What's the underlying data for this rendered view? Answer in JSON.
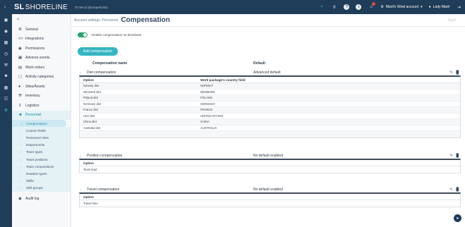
{
  "topbar": {
    "brand_logo": "SL",
    "brand_name": "SHORELINE",
    "timezone": "07:59:43 (Europe/Oslo)",
    "account_label": "Marit's Wind account",
    "user_label": "Lady Marit",
    "icons": [
      "menu-icon",
      "wifi-icon",
      "search-icon",
      "help-icon",
      "info-icon",
      "bell-icon",
      "gear-icon",
      "user-icon",
      "logout-icon"
    ]
  },
  "rail": {
    "icons": [
      "dashboard-icon",
      "location-icon",
      "folder-icon",
      "clock-icon",
      "wrench-icon",
      "team-icon",
      "calendar-icon",
      "grid-icon",
      "settings-icon"
    ]
  },
  "sidebar": {
    "back_label": "<",
    "items": [
      {
        "label": "General",
        "icon": "gear-icon"
      },
      {
        "label": "Integrations",
        "icon": "code-icon"
      },
      {
        "label": "Permissions",
        "icon": "shield-icon"
      },
      {
        "label": "Adverse events",
        "icon": "calendar-icon"
      },
      {
        "label": "Work orders",
        "icon": "clipboard-icon"
      },
      {
        "label": "Activity categories",
        "icon": "tag-icon"
      },
      {
        "label": "Sites/Assets",
        "icon": "pin-icon"
      },
      {
        "label": "Inventory",
        "icon": "wrench-icon"
      },
      {
        "label": "Logistics",
        "icon": "route-icon"
      },
      {
        "label": "Personnel",
        "icon": "person-icon"
      }
    ],
    "personnel_subitems": [
      "Compensation",
      "Custom fields",
      "Personnel roles",
      "Departments",
      "Team types",
      "Team positions",
      "Team compositions",
      "Rotation types",
      "Skills",
      "Skill groups"
    ],
    "audit_label": "Audit log"
  },
  "header": {
    "breadcrumb": "Account settings: Personnel:",
    "title": "Compensation",
    "save_label": "Save"
  },
  "toggle": {
    "label": "Enable compensation on timesheet",
    "enabled": true
  },
  "add_button_label": "Add compensation",
  "table": {
    "col_name": "Compensation name",
    "col_default": "Default"
  },
  "sections": [
    {
      "name": "Diet compensation",
      "default": "Advanced default",
      "col1": "Option",
      "col2": "Work package's country field",
      "rows": [
        [
          "Norway diet",
          "NORWAY"
        ],
        [
          "Denmark diet",
          "DENMARK"
        ],
        [
          "Poland diet",
          "POLAND"
        ],
        [
          "Germany diet",
          "GERMANY"
        ],
        [
          "France diet",
          "FRANCE"
        ],
        [
          "USA diet",
          "UNITED STATES"
        ],
        [
          "China diet",
          "CHINA"
        ],
        [
          "Australia diet",
          "AUSTRALIA"
        ]
      ]
    },
    {
      "name": "Position compensation",
      "default": "No default enabled",
      "col1": "Option",
      "rows": [
        [
          "Team lead"
        ]
      ]
    },
    {
      "name": "Travel compensation",
      "default": "No default enabled",
      "col1": "Option",
      "rows": [
        [
          "Travel time"
        ]
      ]
    }
  ]
}
